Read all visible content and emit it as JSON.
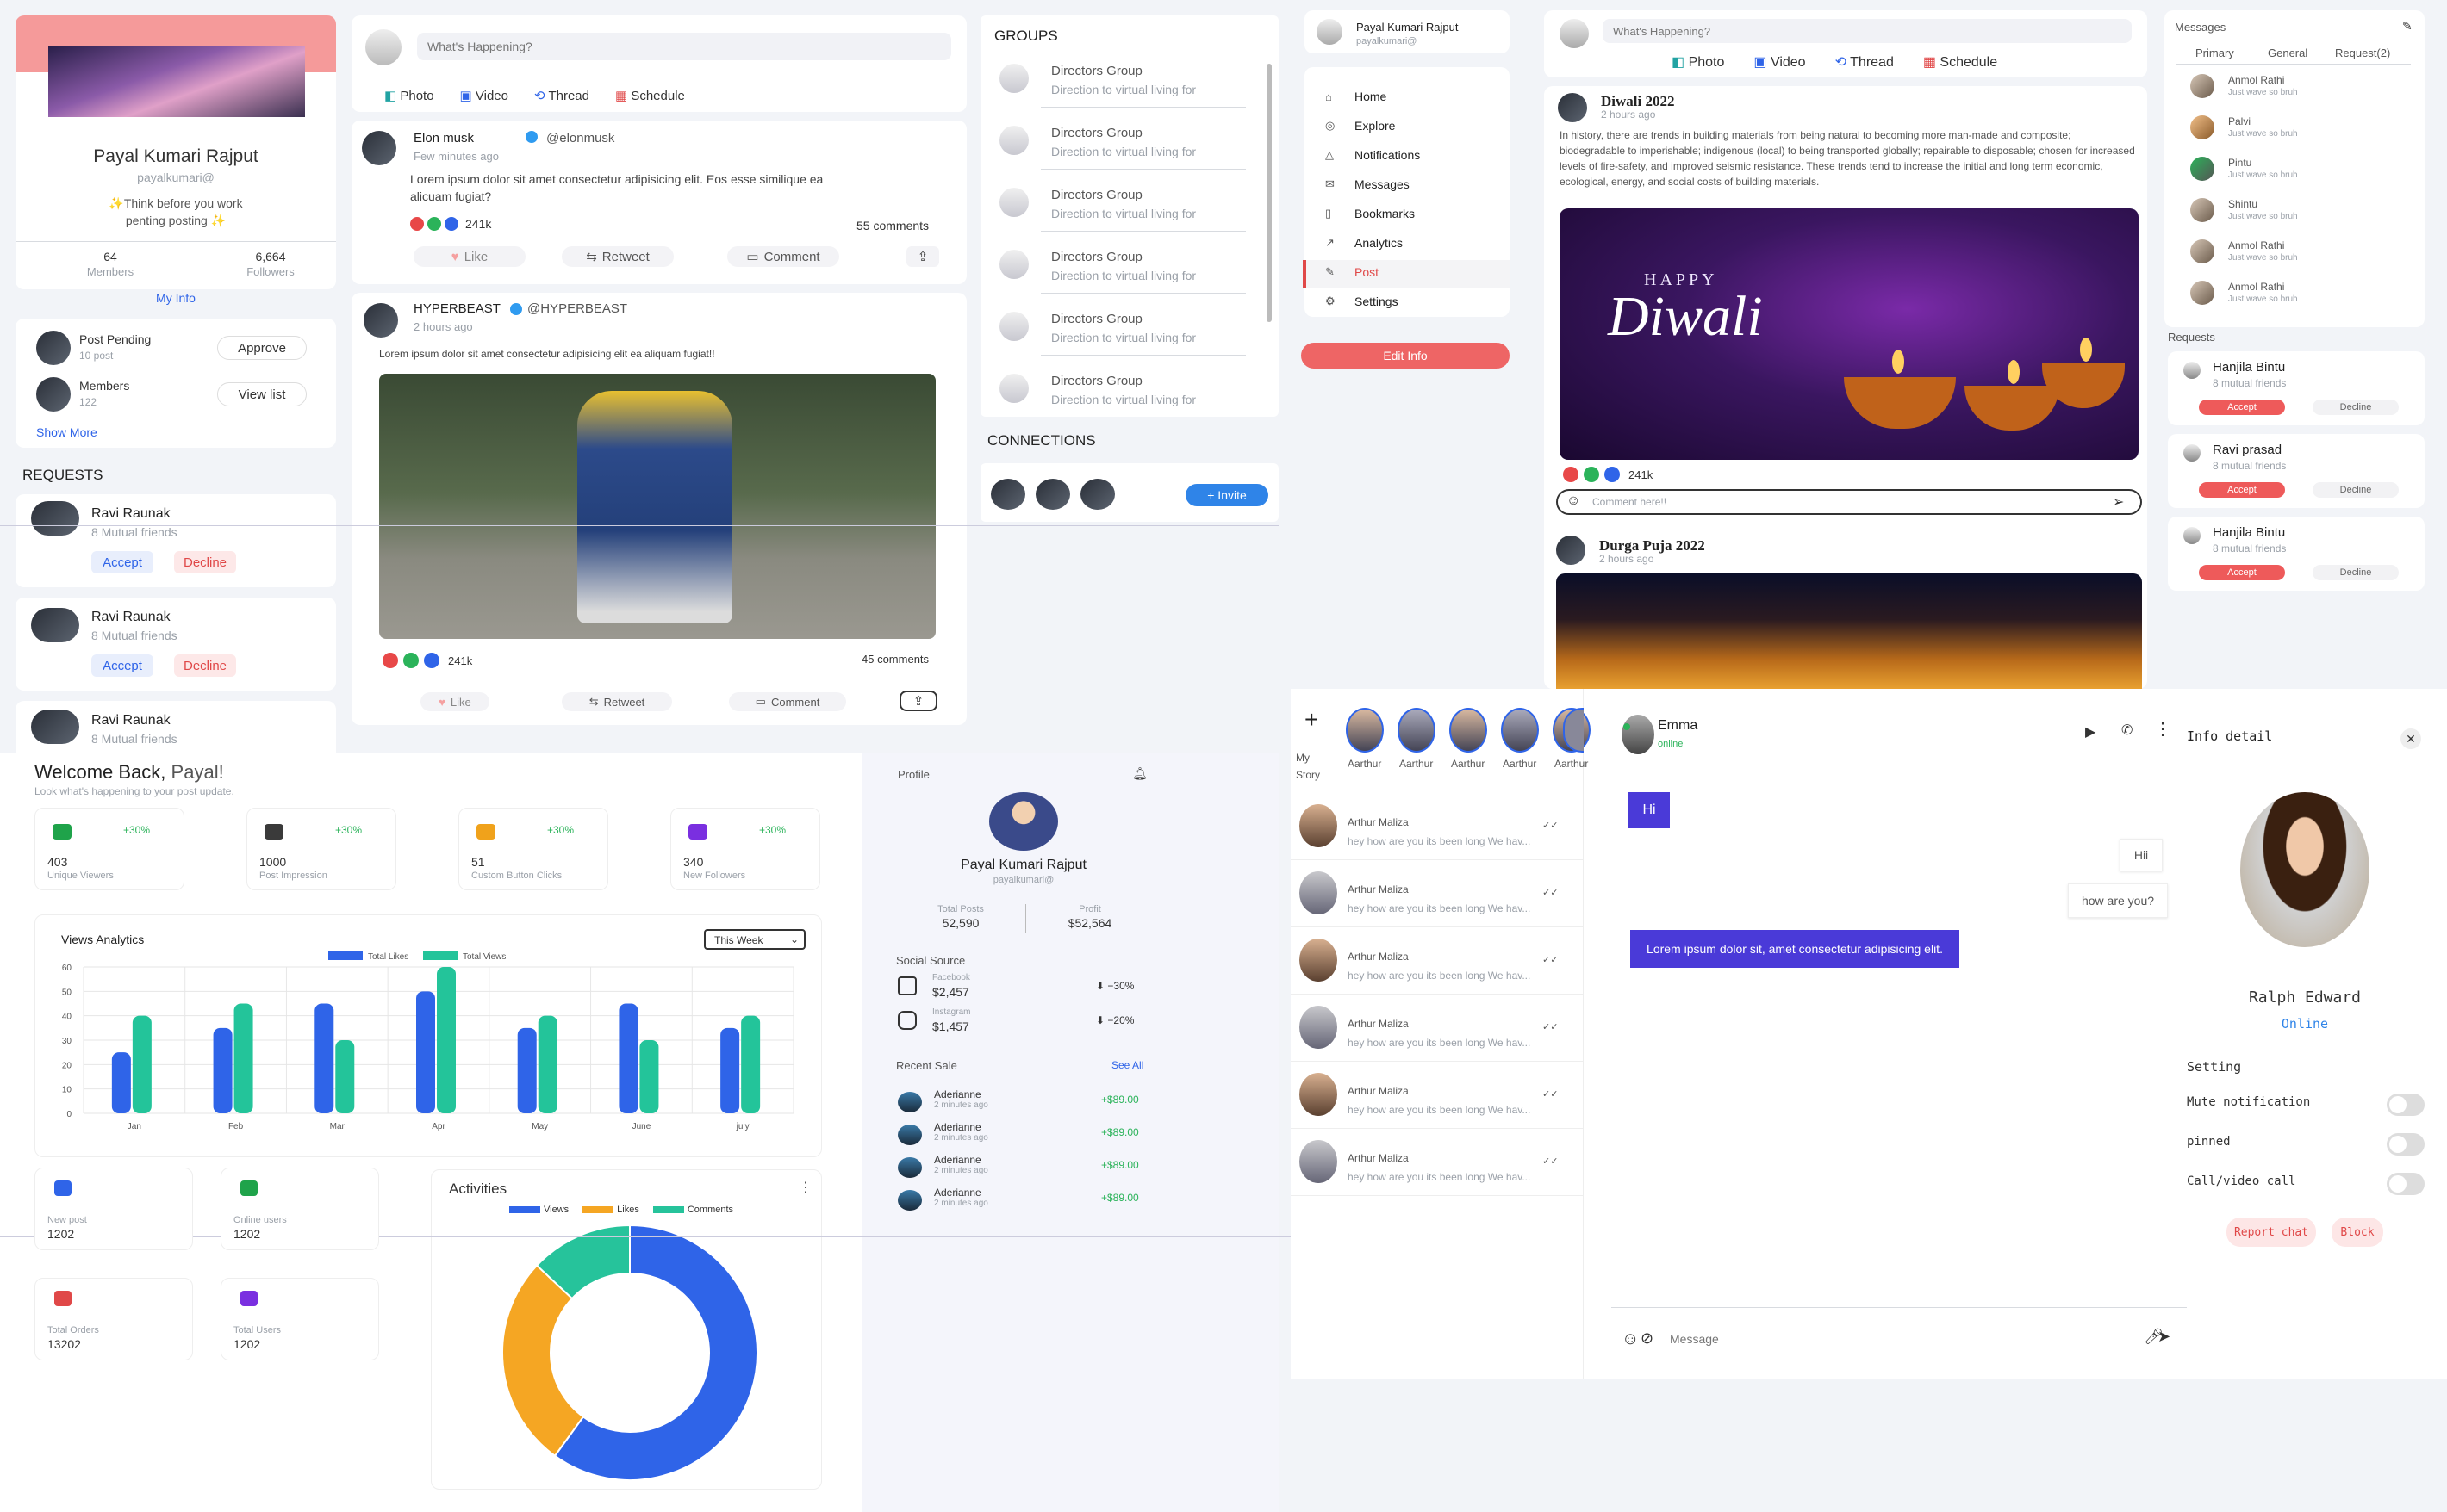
{
  "q1": {
    "profile": {
      "name": "Payal Kumari Rajput",
      "handle": "payalkumari@",
      "bio": "✨Think before you work penting posting ✨",
      "stats": [
        {
          "value": "64",
          "label": "Members"
        },
        {
          "value": "6,664",
          "label": "Followers"
        }
      ],
      "my_info": "My Info"
    },
    "pending": {
      "rows": [
        {
          "title": "Post Pending",
          "sub": "10 post",
          "action": "Approve"
        },
        {
          "title": "Members",
          "sub": "122",
          "action": "View list"
        }
      ],
      "show_more": "Show More"
    },
    "requests_heading": "REQUESTS",
    "requests": [
      {
        "name": "Ravi Raunak",
        "sub": "8 Mutual friends",
        "accept": "Accept",
        "decline": "Decline"
      },
      {
        "name": "Ravi Raunak",
        "sub": "8 Mutual friends",
        "accept": "Accept",
        "decline": "Decline"
      },
      {
        "name": "Ravi Raunak",
        "sub": "8 Mutual friends"
      }
    ],
    "composer": {
      "placeholder": "What's Happening?",
      "actions": [
        "Photo",
        "Video",
        "Thread",
        "Schedule"
      ]
    },
    "post1": {
      "name": "Elon musk",
      "handle": "@elonmusk",
      "time": "Few minutes ago",
      "text": "Lorem ipsum dolor sit amet consectetur adipisicing elit. Eos esse similique ea alicuam fugiat?",
      "count": "241k",
      "comments": "55 comments",
      "actions": [
        "Like",
        "Retweet",
        "Comment"
      ]
    },
    "post2": {
      "name": "HYPERBEAST",
      "handle": "@HYPERBEAST",
      "time": "2 hours ago",
      "text": "Lorem ipsum dolor sit amet consectetur adipisicing elit ea aliquam fugiat!!",
      "count": "241k",
      "comments": "45 comments",
      "actions": [
        "Like",
        "Retweet",
        "Comment"
      ]
    },
    "groups_heading": "GROUPS",
    "groups": [
      {
        "name": "Directors Group",
        "sub": "Direction to virtual living for"
      },
      {
        "name": "Directors Group",
        "sub": "Direction to virtual living for"
      },
      {
        "name": "Directors Group",
        "sub": "Direction to virtual living for"
      },
      {
        "name": "Directors Group",
        "sub": "Direction to virtual living for"
      },
      {
        "name": "Directors Group",
        "sub": "Direction to virtual living for"
      },
      {
        "name": "Directors Group",
        "sub": "Direction to virtual living for"
      }
    ],
    "connections_heading": "CONNECTIONS",
    "invite": "+ Invite"
  },
  "q2": {
    "user": {
      "name": "Payal Kumari Rajput",
      "handle": "payalkumari@"
    },
    "nav": [
      "Home",
      "Explore",
      "Notifications",
      "Messages",
      "Bookmarks",
      "Analytics",
      "Post",
      "Settings"
    ],
    "edit": "Edit Info",
    "composer": {
      "placeholder": "What's Happening?",
      "actions": [
        "Photo",
        "Video",
        "Thread",
        "Schedule"
      ]
    },
    "post1": {
      "title": "Diwali 2022",
      "time": "2 hours ago",
      "text": "In history, there are trends in building materials from being natural to becoming more man-made and composite; biodegradable to imperishable; indigenous (local) to being transported globally; repairable to disposable; chosen for increased levels of fire-safety, and improved seismic resistance. These trends tend to increase the initial and long term economic, ecological, energy, and social costs of building materials.",
      "image_text": "HAPPY",
      "image_script": "Diwali",
      "count": "241k",
      "comment_placeholder": "Comment here!!"
    },
    "post2": {
      "title": "Durga Puja 2022",
      "time": "2 hours ago"
    },
    "messages": {
      "title": "Messages",
      "tabs": [
        "Primary",
        "General",
        "Request(2)"
      ],
      "items": [
        {
          "name": "Anmol Rathi",
          "sub": "Just wave so bruh"
        },
        {
          "name": "Palvi",
          "sub": "Just wave so bruh"
        },
        {
          "name": "Pintu",
          "sub": "Just wave so bruh"
        },
        {
          "name": "Shintu",
          "sub": "Just wave so bruh"
        },
        {
          "name": "Anmol Rathi",
          "sub": "Just wave so bruh"
        },
        {
          "name": "Anmol Rathi",
          "sub": "Just wave so bruh"
        }
      ]
    },
    "requests_heading": "Requests",
    "requests": [
      {
        "name": "Hanjila Bintu",
        "sub": "8 mutual friends",
        "accept": "Accept",
        "decline": "Decline"
      },
      {
        "name": "Ravi prasad",
        "sub": "8 mutual friends",
        "accept": "Accept",
        "decline": "Decline"
      },
      {
        "name": "Hanjila Bintu",
        "sub": "8 mutual friends",
        "accept": "Accept",
        "decline": "Decline"
      }
    ]
  },
  "q3": {
    "welcome_prefix": "Welcome Back, ",
    "welcome_name": "Payal!",
    "subtitle": "Look what's happening to your post update.",
    "stats": [
      {
        "value": "403",
        "label": "Unique Viewers",
        "delta": "+30%",
        "color": "#1fa34a"
      },
      {
        "value": "1000",
        "label": "Post Impression",
        "delta": "+30%",
        "color": "#3a3a3a"
      },
      {
        "value": "51",
        "label": "Custom Button Clicks",
        "delta": "+30%",
        "color": "#f0a21b"
      },
      {
        "value": "340",
        "label": "New Followers",
        "delta": "+30%",
        "color": "#7a2fe0"
      }
    ],
    "chart_data": {
      "type": "bar",
      "title": "Views Analytics",
      "categories": [
        "Jan",
        "Feb",
        "Mar",
        "Apr",
        "May",
        "June",
        "july"
      ],
      "series": [
        {
          "name": "Total Likes",
          "color": "#2f64e8",
          "values": [
            25,
            35,
            45,
            50,
            35,
            45,
            35
          ]
        },
        {
          "name": "Total Views",
          "color": "#23c49a",
          "values": [
            40,
            45,
            30,
            60,
            40,
            30,
            40
          ]
        }
      ],
      "ylim": [
        0,
        60
      ],
      "yticks": [
        0,
        10,
        20,
        30,
        40,
        50,
        60
      ],
      "grid": true,
      "legend": "top-center"
    },
    "range": "This Week",
    "small": [
      {
        "label": "New post",
        "value": "1202"
      },
      {
        "label": "Online users",
        "value": "1202"
      },
      {
        "label": "Total Orders",
        "value": "13202"
      },
      {
        "label": "Total Users",
        "value": "1202"
      }
    ],
    "activities": {
      "title": "Activities",
      "chart_data": {
        "type": "pie",
        "series": [
          {
            "name": "Views",
            "color": "#2f64e8",
            "value": 60
          },
          {
            "name": "Likes",
            "color": "#f5a623",
            "value": 27
          },
          {
            "name": "Comments",
            "color": "#26c39b",
            "value": 13
          }
        ]
      }
    },
    "profile": {
      "title": "Profile",
      "name": "Payal Kumari Rajput",
      "handle": "payalkumari@",
      "total_posts_label": "Total Posts",
      "total_posts": "52,590",
      "profit_label": "Profit",
      "profit": "$52,564"
    },
    "social_title": "Social Source",
    "social": [
      {
        "name": "Facebook",
        "value": "$2,457",
        "delta": "⬇ −30%"
      },
      {
        "name": "Instagram",
        "value": "$1,457",
        "delta": "⬇ −20%"
      }
    ],
    "recent": {
      "title": "Recent Sale",
      "see_all": "See All",
      "items": [
        {
          "name": "Aderianne",
          "time": "2 minutes ago",
          "amount": "+$89.00"
        },
        {
          "name": "Aderianne",
          "time": "2 minutes ago",
          "amount": "+$89.00"
        },
        {
          "name": "Aderianne",
          "time": "2 minutes ago",
          "amount": "+$89.00"
        },
        {
          "name": "Aderianne",
          "time": "2 minutes ago",
          "amount": "+$89.00"
        }
      ]
    }
  },
  "q4": {
    "my_story": "My Story",
    "stories": [
      "Aarthur",
      "Aarthur",
      "Aarthur",
      "Aarthur",
      "Aarthur"
    ],
    "chats": [
      {
        "name": "Arthur Maliza",
        "msg": "hey how are you its been long We hav..."
      },
      {
        "name": "Arthur Maliza",
        "msg": "hey how are you its been long We hav..."
      },
      {
        "name": "Arthur Maliza",
        "msg": "hey how are you its been long We hav..."
      },
      {
        "name": "Arthur Maliza",
        "msg": "hey how are you its been long We hav..."
      },
      {
        "name": "Arthur Maliza",
        "msg": "hey how are you its been long We hav..."
      },
      {
        "name": "Arthur Maliza",
        "msg": "hey how are you its been long We hav..."
      }
    ],
    "contact": {
      "name": "Emma",
      "status": "online"
    },
    "bubbles": {
      "hi": "Hi",
      "hii": "Hii",
      "how": "how are you?",
      "lorem": "Lorem ipsum dolor sit, amet consectetur adipisicing elit."
    },
    "input_placeholder": "Message",
    "info": {
      "title": "Info detail",
      "name": "Ralph Edward",
      "status": "Online",
      "setting": "Setting",
      "toggles": [
        "Mute notification",
        "pinned",
        "Call/video call"
      ],
      "report": "Report chat",
      "block": "Block"
    }
  }
}
